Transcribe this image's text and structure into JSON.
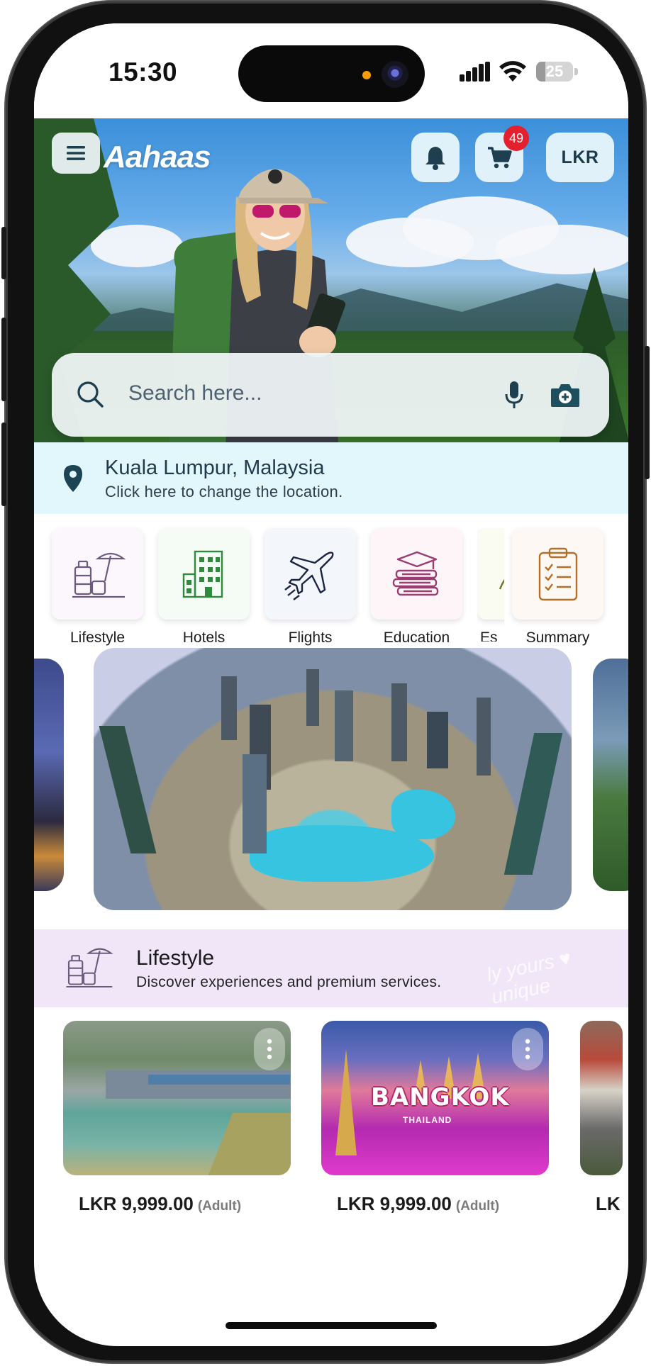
{
  "status_bar": {
    "time": "15:30",
    "battery_level": "25",
    "battery_fraction": 0.25
  },
  "header": {
    "app_name": "Aahaas",
    "menu_icon": "hamburger-menu-icon",
    "notification_icon": "bell-icon",
    "cart_icon": "cart-icon",
    "cart_count": "49",
    "currency": "LKR",
    "brand_color": "#ffffff",
    "badge_color": "#e5202e"
  },
  "search": {
    "placeholder": "Search here...",
    "search_icon": "search-icon",
    "voice_icon": "microphone-icon",
    "camera_icon": "camera-icon"
  },
  "location": {
    "city": "Kuala Lumpur, Malaysia",
    "hint": "Click here to change the location.",
    "icon": "location-pin-icon"
  },
  "categories": [
    {
      "label": "Lifestyle",
      "icon": "lifestyle-icon",
      "color": "#8a6fa6"
    },
    {
      "label": "Hotels",
      "icon": "hotel-building-icon",
      "color": "#2f8a3e"
    },
    {
      "label": "Flights",
      "icon": "airplane-icon",
      "color": "#1b2440"
    },
    {
      "label": "Education",
      "icon": "education-books-icon",
      "color": "#9b3d70"
    },
    {
      "label": "Es",
      "icon": "essentials-icon",
      "color": "#6b7a2f"
    },
    {
      "label": "Summary",
      "icon": "clipboard-icon",
      "color": "#b3702a"
    }
  ],
  "section": {
    "title": "Lifestyle",
    "subtitle": "Discover experiences and premium services.",
    "watermark": "ly yours ♥ unique",
    "icon": "lifestyle-icon"
  },
  "products": [
    {
      "price": "LKR 9,999.00",
      "unit": "(Adult)",
      "more_icon": "more-vertical-icon"
    },
    {
      "price": "LKR 9,999.00",
      "unit": "(Adult)",
      "more_icon": "more-vertical-icon",
      "image_text": "BANGKOK",
      "image_subtext": "THAILAND"
    },
    {
      "price": "LK",
      "unit": ""
    }
  ]
}
